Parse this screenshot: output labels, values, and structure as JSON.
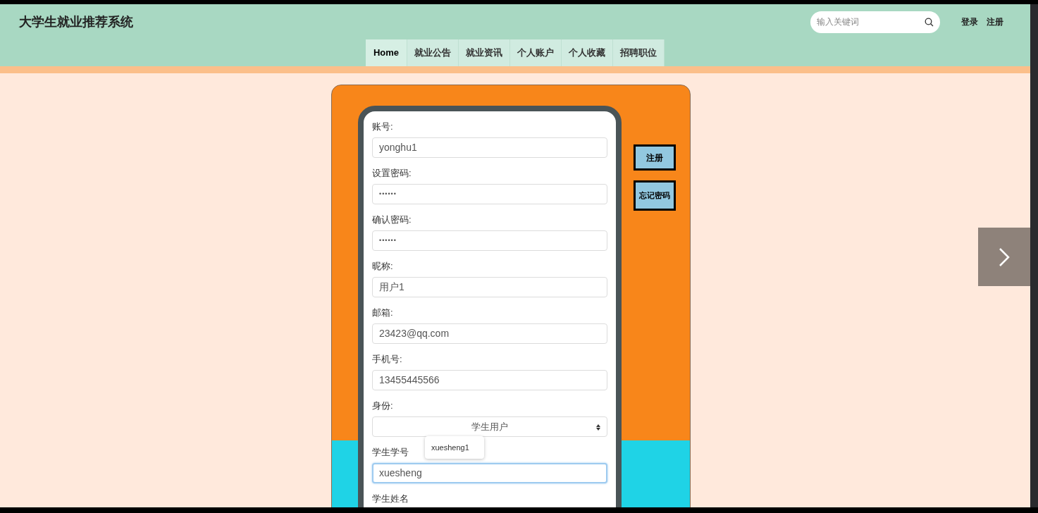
{
  "header": {
    "title": "大学生就业推荐系统",
    "search": {
      "placeholder": "输入关键词"
    },
    "links": [
      "登录",
      "注册"
    ]
  },
  "nav": [
    {
      "label": "Home",
      "selected": true
    },
    {
      "label": "就业公告",
      "selected": false
    },
    {
      "label": "就业资讯",
      "selected": false
    },
    {
      "label": "个人账户",
      "selected": false
    },
    {
      "label": "个人收藏",
      "selected": false
    },
    {
      "label": "招聘职位",
      "selected": false
    }
  ],
  "form": {
    "fields": [
      {
        "label": "账号:",
        "kind": "text",
        "value": "yonghu1",
        "focused": false
      },
      {
        "label": "设置密码:",
        "kind": "password",
        "value": "••••••",
        "focused": false
      },
      {
        "label": "确认密码:",
        "kind": "password",
        "value": "••••••",
        "focused": false
      },
      {
        "label": "昵称:",
        "kind": "text",
        "value": "用户1",
        "focused": false
      },
      {
        "label": "邮箱:",
        "kind": "text",
        "value": "23423@qq.com",
        "focused": false
      },
      {
        "label": "手机号:",
        "kind": "text",
        "value": "13455445566",
        "focused": false
      },
      {
        "label": "身份:",
        "kind": "select",
        "value": "学生用户",
        "focused": false
      },
      {
        "label": "学生学号",
        "kind": "text",
        "value": "xuesheng",
        "focused": true,
        "suggestion": "xuesheng1"
      },
      {
        "label": "学生姓名",
        "kind": "label_only"
      }
    ]
  },
  "side_buttons": [
    "注册",
    "忘记密码"
  ]
}
